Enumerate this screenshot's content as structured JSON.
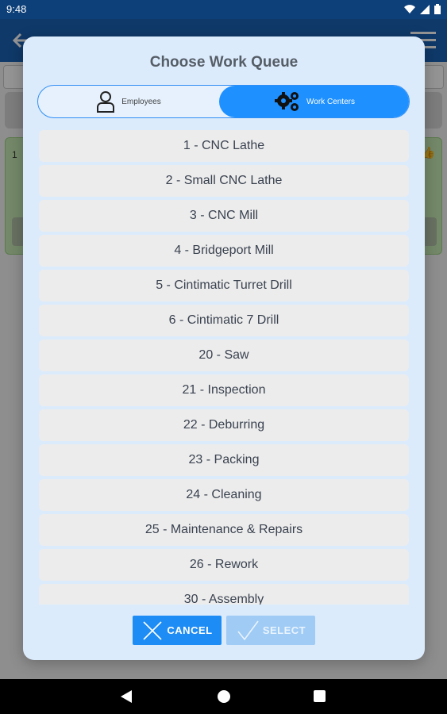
{
  "status_bar": {
    "time": "9:48"
  },
  "dialog": {
    "title": "Choose Work Queue",
    "tabs": {
      "employees": "Employees",
      "work_centers": "Work Centers"
    },
    "selected_tab": "Work Centers",
    "items": [
      "1 - CNC Lathe",
      "2 - Small CNC Lathe",
      "3 - CNC Mill",
      "4 - Bridgeport Mill",
      "5 - Cintimatic Turret Drill",
      "6 - Cintimatic 7 Drill",
      "20 - Saw",
      "21 - Inspection",
      "22 - Deburring",
      "23 - Packing",
      "24 - Cleaning",
      "25 - Maintenance & Repairs",
      "26 - Rework",
      "30 - Assembly"
    ],
    "cancel_label": "CANCEL",
    "select_label": "SELECT"
  },
  "background": {
    "card_number": "1"
  },
  "colors": {
    "accent": "#1e90ff",
    "app_bar": "#1b62b6",
    "status_bar": "#0d3f78",
    "dialog_bg": "#dcebfc"
  },
  "icons": [
    "wifi-icon",
    "signal-icon",
    "battery-icon",
    "back-arrow-icon",
    "menu-icon",
    "person-icon",
    "gears-icon",
    "close-x-icon",
    "checkmark-icon",
    "nav-back-icon",
    "nav-home-icon",
    "nav-recents-icon"
  ]
}
